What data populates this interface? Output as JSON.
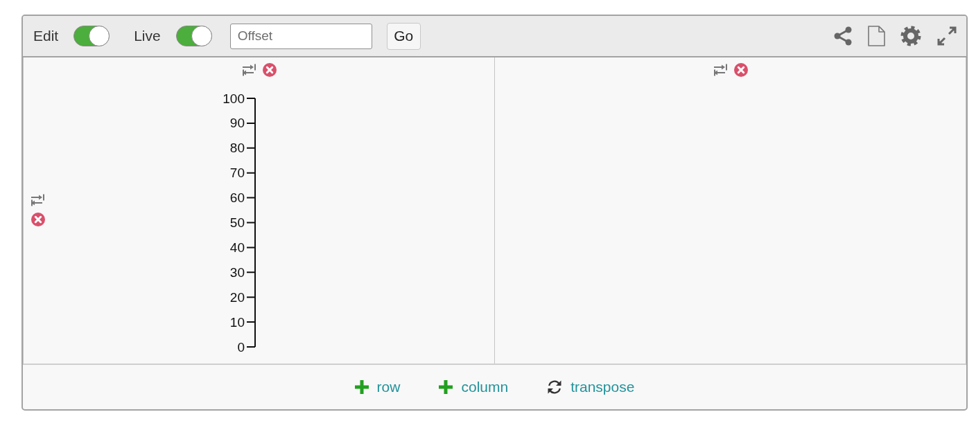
{
  "toolbar": {
    "toggles": [
      {
        "label": "Edit",
        "on": true
      },
      {
        "label": "Live",
        "on": true
      }
    ],
    "offset_field": {
      "placeholder": "Offset"
    },
    "go_button": {
      "label": "Go"
    }
  },
  "grid": {
    "rows": [
      {
        "cells": [
          {
            "kind": "axis",
            "axis_labels": [
              "100",
              "90",
              "80",
              "70",
              "60",
              "50",
              "40",
              "30",
              "20",
              "10",
              "0"
            ]
          },
          {
            "kind": "empty"
          }
        ]
      }
    ]
  },
  "footer": {
    "actions": [
      {
        "kind": "add",
        "label": "row"
      },
      {
        "kind": "add",
        "label": "column"
      },
      {
        "kind": "transpose",
        "label": "transpose"
      }
    ]
  }
}
